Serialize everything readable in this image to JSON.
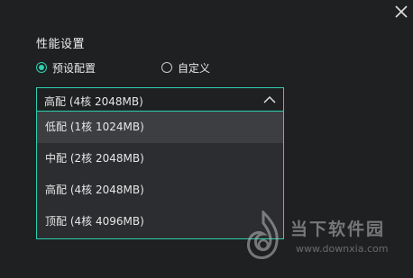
{
  "section": {
    "title": "性能设置"
  },
  "options": {
    "preset_label": "预设配置",
    "custom_label": "自定义",
    "selected": "preset"
  },
  "select": {
    "value": "高配 (4核 2048MB)"
  },
  "dropdown": {
    "items": [
      {
        "label": "低配 (1核 1024MB)"
      },
      {
        "label": "中配 (2核 2048MB)"
      },
      {
        "label": "高配 (4核 2048MB)"
      },
      {
        "label": "顶配 (4核 4096MB)"
      }
    ],
    "hovered_index": 0
  },
  "watermark": {
    "title": "当下软件园",
    "url": "www.downxia.com"
  },
  "colors": {
    "accent": "#2ed0b0",
    "background": "#1e2022",
    "dropdown_bg": "#2b2d30",
    "hover_bg": "#3c3e42"
  },
  "icons": {
    "close": "close-icon",
    "chevron": "chevron-up-icon",
    "logo": "watermark-logo-icon"
  }
}
